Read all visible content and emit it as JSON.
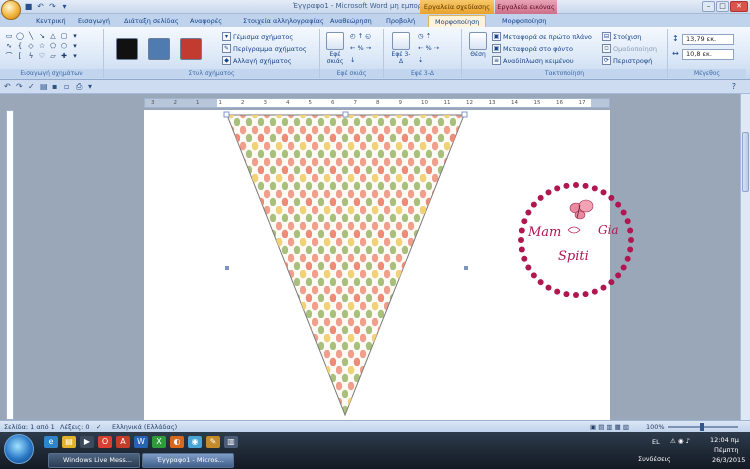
{
  "window": {
    "title": "Έγγραφο1 - Microsoft Word μη εμπορική χρήση",
    "context_drawing": "Εργαλεία σχεδίασης",
    "context_picture": "Εργαλεία εικόνας"
  },
  "tabs": [
    "Κεντρική",
    "Εισαγωγή",
    "Διάταξη σελίδας",
    "Αναφορές",
    "Στοιχεία αλληλογραφίας",
    "Αναθεώρηση",
    "Προβολή",
    "Μορφοποίηση",
    "Μορφοποίηση"
  ],
  "ribbon": {
    "insert_shapes_label": "Εισαγωγή σχημάτων",
    "shape_styles_label": "Στυλ σχήματος",
    "swatches": [
      "#111111",
      "#4f7bb0",
      "#c23b31"
    ],
    "fill_label": "Γέμισμα σχήματος",
    "outline_label": "Περίγραμμα σχήματος",
    "change_label": "Αλλαγή σχήματος",
    "shadow_btn_label": "Εφέ σκιάς",
    "shadow_group_label": "Εφέ σκιάς",
    "threed_btn_label": "Εφέ 3-Δ",
    "threed_group_label": "Εφέ 3-Δ",
    "position_label": "Θέση",
    "bring_front": "Μεταφορά σε πρώτο πλάνο",
    "send_back": "Μεταφορά στο φόντο",
    "text_wrap": "Αναδίπλωση κειμένου",
    "align": "Στοίχιση",
    "group": "Ομαδοποίηση",
    "rotate": "Περιστροφή",
    "arrange_label": "Τακτοποίηση",
    "height": "13,79 εκ.",
    "width": "10,8 εκ.",
    "size_label": "Μέγεθος"
  },
  "ruler_ticks": [
    "3",
    "2",
    "1",
    "1",
    "2",
    "3",
    "4",
    "5",
    "6",
    "7",
    "8",
    "9",
    "10",
    "11",
    "12",
    "13",
    "14",
    "15",
    "16",
    "17"
  ],
  "logo": {
    "line1": "Mam",
    "line1b": "Gia",
    "line2": "Spiti",
    "ring_color": "#b0164f"
  },
  "statusbar": {
    "page": "Σελίδα: 1 από 1",
    "words": "Λέξεις: 0",
    "language": "Ελληνικά (Ελλάδας)",
    "zoom": "100%"
  },
  "taskbar": {
    "btn1": "Windows Live Mess...",
    "btn2": "Έγγραφο1 - Micros...",
    "connections": "Συνδέσεις",
    "lang": "EL",
    "time": "12:04 πμ",
    "day": "Πέμπτη",
    "date": "26/3/2015"
  }
}
